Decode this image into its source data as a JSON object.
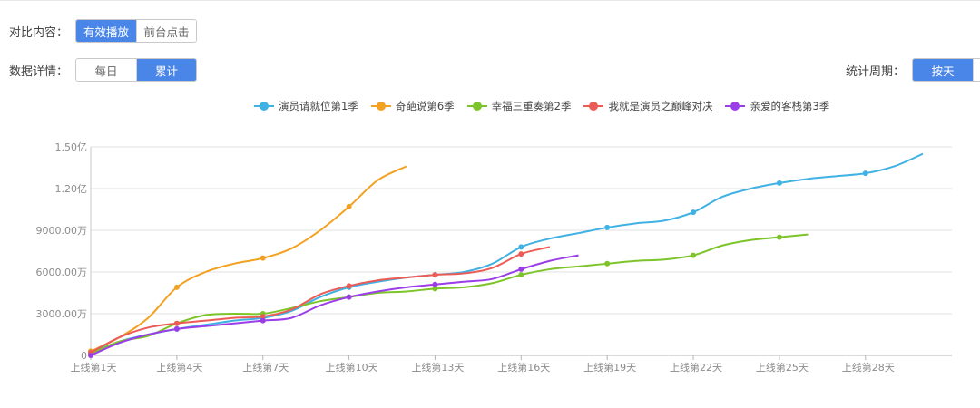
{
  "compare": {
    "label": "对比内容：",
    "options": [
      "有效播放",
      "前台点击"
    ],
    "active": 0
  },
  "details": {
    "label": "数据详情：",
    "options": [
      "每日",
      "累计"
    ],
    "active": 1
  },
  "period": {
    "label": "统计周期：",
    "options": [
      "按天"
    ],
    "active": 0
  },
  "chart_data": {
    "type": "line",
    "x": [
      "上线第1天",
      "上线第2天",
      "上线第3天",
      "上线第4天",
      "上线第5天",
      "上线第6天",
      "上线第7天",
      "上线第8天",
      "上线第9天",
      "上线第10天",
      "上线第11天",
      "上线第12天",
      "上线第13天",
      "上线第14天",
      "上线第15天",
      "上线第16天",
      "上线第17天",
      "上线第18天",
      "上线第19天",
      "上线第20天",
      "上线第21天",
      "上线第22天",
      "上线第23天",
      "上线第24天",
      "上线第25天",
      "上线第26天",
      "上线第27天",
      "上线第28天",
      "上线第29天",
      "上线第30天"
    ],
    "xticks": [
      "上线第1天",
      "上线第4天",
      "上线第7天",
      "上线第10天",
      "上线第13天",
      "上线第16天",
      "上线第19天",
      "上线第22天",
      "上线第25天",
      "上线第28天"
    ],
    "yticks": [
      {
        "value": 0,
        "label": "0"
      },
      {
        "value": 30000000,
        "label": "3000.00万"
      },
      {
        "value": 60000000,
        "label": "6000.00万"
      },
      {
        "value": 90000000,
        "label": "9000.00万"
      },
      {
        "value": 120000000,
        "label": "1.20亿"
      },
      {
        "value": 150000000,
        "label": "1.50亿"
      }
    ],
    "ylim": [
      0,
      150000000
    ],
    "grid": true,
    "legend_position": "top",
    "series": [
      {
        "name": "演员请就位第1季",
        "color": "#3fb1e3",
        "values": [
          2000000,
          10000000,
          15000000,
          19000000,
          22000000,
          25000000,
          27000000,
          32000000,
          42000000,
          49000000,
          53000000,
          56000000,
          58000000,
          60000000,
          66000000,
          78000000,
          84000000,
          88000000,
          92000000,
          95000000,
          97000000,
          103000000,
          114000000,
          120000000,
          124000000,
          127000000,
          129000000,
          131000000,
          136000000,
          145000000
        ]
      },
      {
        "name": "奇葩说第6季",
        "color": "#f2a121",
        "values": [
          3000000,
          13000000,
          27000000,
          49000000,
          60000000,
          66000000,
          70000000,
          77000000,
          90000000,
          107000000,
          126000000,
          136000000
        ]
      },
      {
        "name": "幸福三重奏第2季",
        "color": "#7dc42a",
        "values": [
          1000000,
          10000000,
          14000000,
          23000000,
          29000000,
          30000000,
          30000000,
          34000000,
          39000000,
          42000000,
          45000000,
          46000000,
          48000000,
          49000000,
          52000000,
          58000000,
          62000000,
          64000000,
          66000000,
          68000000,
          69000000,
          72000000,
          79000000,
          83000000,
          85000000,
          87000000
        ]
      },
      {
        "name": "我就是演员之巅峰对决",
        "color": "#ec5b56",
        "values": [
          2000000,
          13000000,
          20000000,
          23000000,
          25000000,
          27000000,
          28000000,
          33000000,
          44000000,
          50000000,
          54000000,
          56000000,
          58000000,
          59000000,
          63000000,
          73000000,
          78000000
        ]
      },
      {
        "name": "亲爱的客栈第3季",
        "color": "#9b3ee8",
        "values": [
          0,
          9000000,
          15000000,
          19000000,
          21000000,
          23000000,
          25000000,
          27000000,
          36000000,
          42000000,
          46000000,
          49000000,
          51000000,
          53000000,
          55000000,
          62000000,
          68000000,
          72000000
        ]
      }
    ]
  }
}
